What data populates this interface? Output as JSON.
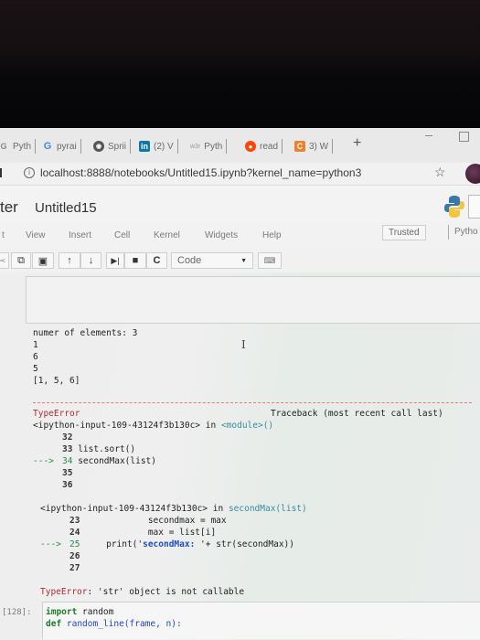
{
  "browser": {
    "tabs": [
      {
        "icon": "G",
        "label": "Pyth"
      },
      {
        "icon": "G",
        "label": "pyrai"
      },
      {
        "icon": "globe",
        "label": "Sprii"
      },
      {
        "icon": "in",
        "label": "(2) V"
      },
      {
        "icon": "w3r",
        "label": "Pyth"
      },
      {
        "icon": "reddit",
        "label": "read"
      },
      {
        "icon": "C",
        "label": "3) W"
      }
    ],
    "new_tab": "+",
    "url": "localhost:8888/notebooks/Untitled15.ipynb?kernel_name=python3",
    "info_icon": "i",
    "star_icon": "☆"
  },
  "jupyter": {
    "logo_text": "ter",
    "notebook_name": "Untitled15",
    "menu": [
      "t",
      "View",
      "Insert",
      "Cell",
      "Kernel",
      "Widgets",
      "Help"
    ],
    "trusted": "Trusted",
    "kernel": "Pytho",
    "toolbar": {
      "cell_type": "Code",
      "buttons": [
        "cut",
        "copy",
        "paste",
        "move-up",
        "move-down",
        "run",
        "interrupt",
        "restart",
        "command-palette"
      ]
    }
  },
  "output": {
    "lines": [
      "numer of elements: 3",
      "1",
      "6",
      "5",
      "[1, 5, 6]"
    ],
    "traceback": {
      "error_type": "TypeError",
      "header_right": "Traceback (most recent call last)",
      "frame1": {
        "location": "<ipython-input-109-43124f3b130c>",
        "in": "in",
        "func": "<module>()",
        "lines": [
          {
            "no": "32",
            "code": "",
            "arrow": ""
          },
          {
            "no": "33",
            "code": "list.sort()",
            "arrow": ""
          },
          {
            "no": "34",
            "code": "secondMax(list)",
            "arrow": "--->"
          },
          {
            "no": "35",
            "code": "",
            "arrow": ""
          },
          {
            "no": "36",
            "code": "",
            "arrow": ""
          }
        ]
      },
      "frame2": {
        "location": "<ipython-input-109-43124f3b130c>",
        "in": "in",
        "func": "secondMax(list)",
        "lines": [
          {
            "no": "23",
            "code": "            secondmax = max",
            "arrow": ""
          },
          {
            "no": "24",
            "code": "            max = list[i]",
            "arrow": ""
          },
          {
            "no": "25",
            "code_pre": "    print('",
            "code_str": "secondMax:",
            "code_post": " '+ str(secondMax))",
            "arrow": "--->"
          },
          {
            "no": "26",
            "code": "",
            "arrow": ""
          },
          {
            "no": "27",
            "code": "",
            "arrow": ""
          }
        ]
      },
      "final_type": "TypeError",
      "final_msg": ": 'str' object is not callable"
    }
  },
  "next_cell": {
    "prompt": "[128]:",
    "line1_kw": "import",
    "line1_rest": " random",
    "line2_kw": "def",
    "line2_rest": " random_line(frame, n):"
  }
}
